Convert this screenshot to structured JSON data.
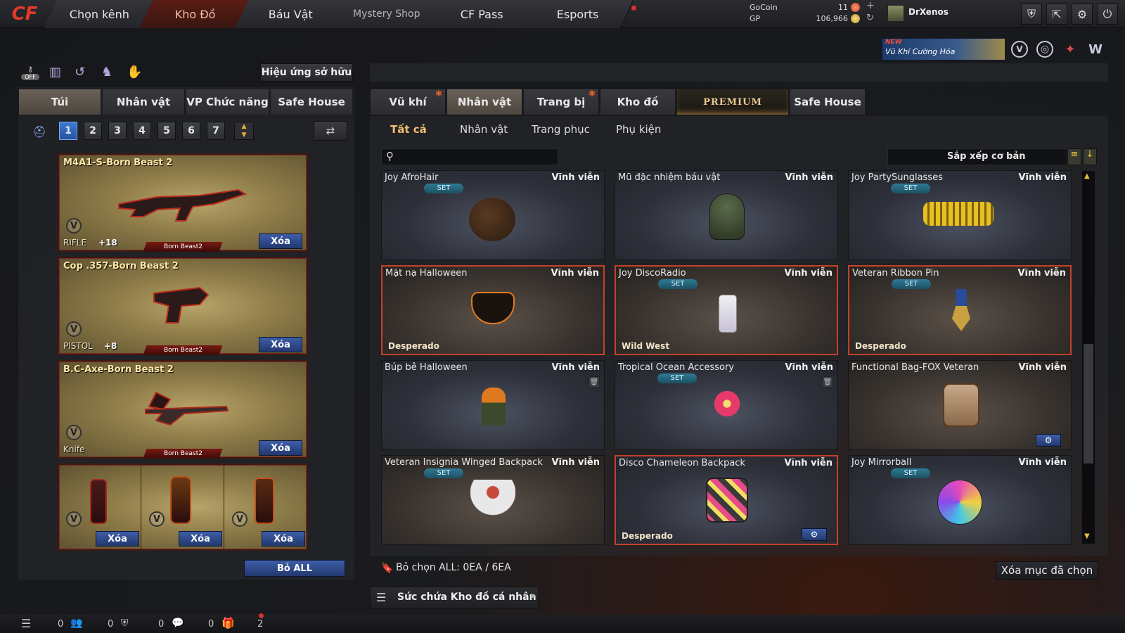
{
  "topnav": {
    "logo": "CF",
    "tabs": [
      "Chọn kênh",
      "Kho Đồ",
      "Báu Vật",
      "Mystery Shop",
      "CF Pass",
      "Esports"
    ],
    "currency": {
      "gocoin_label": "GoCoin",
      "gocoin_value": "11",
      "gp_label": "GP",
      "gp_value": "106,966"
    },
    "username": "DrXenos"
  },
  "banner": {
    "new": "NEW",
    "text": "Vũ Khí Cường Hóa"
  },
  "left": {
    "effect_button": "Hiệu ứng sở hữu",
    "off_label": "OFF",
    "tabs": [
      "Túi",
      "Nhân vật",
      "VP Chức năng",
      "Safe House"
    ],
    "pages": [
      "1",
      "2",
      "3",
      "4",
      "5",
      "6",
      "7"
    ],
    "slots": [
      {
        "name": "M4A1-S-Born Beast 2",
        "type": "RIFLE",
        "plus": "+18",
        "skin": "Born Beast2",
        "delete": "Xóa",
        "v": "V"
      },
      {
        "name": "Cop .357-Born Beast 2",
        "type": "PISTOL",
        "plus": "+8",
        "skin": "Born Beast2",
        "delete": "Xóa",
        "v": "V"
      },
      {
        "name": "B.C-Axe-Born Beast 2",
        "type": "Knife",
        "plus": "",
        "skin": "Born Beast2",
        "delete": "Xóa",
        "v": "V"
      }
    ],
    "grenades": [
      {
        "delete": "Xóa",
        "v": "V"
      },
      {
        "delete": "Xóa",
        "v": "V"
      },
      {
        "delete": "Xóa",
        "v": "V"
      }
    ],
    "clear_all": "Bỏ ALL"
  },
  "right": {
    "tabs": [
      "Vũ khí",
      "Nhân vật",
      "Trang bị",
      "Kho đồ",
      "PREMIUM",
      "Safe House"
    ],
    "subtabs": [
      "Tất cả",
      "Nhân vật",
      "Trang phục",
      "Phụ kiện"
    ],
    "search_placeholder": "",
    "sort_label": "Sắp xếp cơ bản",
    "items": [
      {
        "name": "Joy AfroHair",
        "duration": "Vĩnh viễn",
        "set": "SET",
        "tag": ""
      },
      {
        "name": "Mũ đặc nhiệm báu vật",
        "duration": "Vĩnh viễn",
        "set": "",
        "tag": ""
      },
      {
        "name": "Joy PartySunglasses",
        "duration": "Vĩnh viễn",
        "set": "SET",
        "tag": ""
      },
      {
        "name": "Mặt nạ Halloween",
        "duration": "Vĩnh viễn",
        "set": "",
        "tag": "Desperado"
      },
      {
        "name": "Joy DiscoRadio",
        "duration": "Vĩnh viễn",
        "set": "SET",
        "tag": "Wild West"
      },
      {
        "name": "Veteran Ribbon Pin",
        "duration": "Vĩnh viễn",
        "set": "SET",
        "tag": "Desperado"
      },
      {
        "name": "Búp bê Halloween",
        "duration": "Vĩnh viễn",
        "set": "",
        "tag": ""
      },
      {
        "name": "Tropical Ocean Accessory",
        "duration": "Vĩnh viễn",
        "set": "SET",
        "tag": ""
      },
      {
        "name": "Functional Bag-FOX Veteran",
        "duration": "Vĩnh viễn",
        "set": "",
        "tag": ""
      },
      {
        "name": "Veteran Insignia Winged Backpack",
        "duration": "Vĩnh viễn",
        "set": "SET",
        "tag": ""
      },
      {
        "name": "Disco Chameleon Backpack",
        "duration": "Vĩnh viễn",
        "set": "",
        "tag": "Desperado"
      },
      {
        "name": "Joy Mirrorball",
        "duration": "Vĩnh viễn",
        "set": "SET",
        "tag": ""
      }
    ],
    "deselect_all": "Bỏ chọn ALL: 0EA / 6EA",
    "delete_selected": "Xóa mục đã chọn",
    "capacity": "Sức chứa Kho đồ cá nhân"
  },
  "bottombar": {
    "counts": [
      "0",
      "0",
      "0",
      "0",
      "2"
    ]
  }
}
